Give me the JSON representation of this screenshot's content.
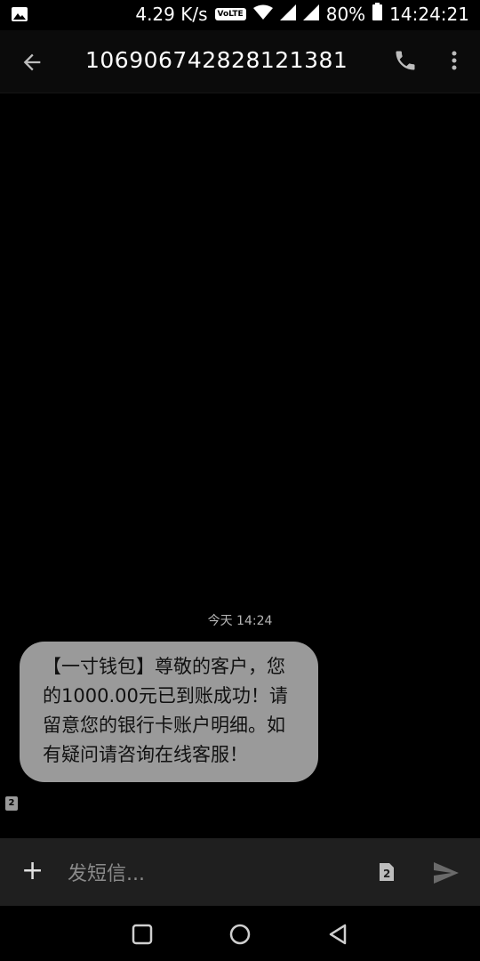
{
  "status_bar": {
    "speed": "4.29 K/s",
    "volte": "VoLTE",
    "battery": "80%",
    "time": "14:24:21"
  },
  "header": {
    "title": "106906742828121381"
  },
  "thread": {
    "timestamp": "今天 14:24",
    "message": "【一寸钱包】尊敬的客户，您的1000.00元已到账成功！请留意您的银行卡账户明细。如有疑问请咨询在线客服！",
    "sim_label": "2"
  },
  "composer": {
    "plus": "+",
    "placeholder": "发短信...",
    "sim_label": "2"
  },
  "colors": {
    "bubble": "#9a9a9a",
    "background": "#000000",
    "composer": "#1f1f1f"
  }
}
